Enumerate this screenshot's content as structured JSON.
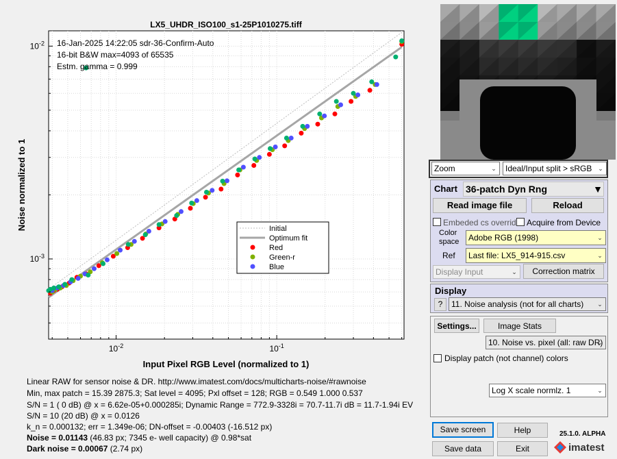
{
  "chart_data": {
    "type": "scatter",
    "title": "LX5_UHDR_ISO100_s1-25P1010275.tiff",
    "xlabel": "Input Pixel RGB Level (normalized to 1)",
    "ylabel": "Noise  normalized to 1",
    "xscale": "log",
    "yscale": "log",
    "xlim": [
      0.0038,
      0.62
    ],
    "ylim": [
      0.00042,
      0.0118
    ],
    "x_ticks": [
      {
        "value": 0.01,
        "label": "10^-2"
      },
      {
        "value": 0.1,
        "label": "10^-1"
      }
    ],
    "y_ticks": [
      {
        "value": 0.001,
        "label": "10^-3"
      },
      {
        "value": 0.01,
        "label": "10^-2"
      }
    ],
    "grid": true,
    "legend_position": "center-right",
    "annotations": [
      "16-Jan-2025 14:22:05   sdr-36-Confirm-Auto",
      "16-bit B&W  max=4093 of 65535",
      "Estm. gamma = 0.999"
    ],
    "series": [
      {
        "name": "Initial",
        "kind": "line",
        "color": "#bdbdbd",
        "x": [
          0.0038,
          0.6
        ],
        "y": [
          0.00072,
          0.0116
        ]
      },
      {
        "name": "Optimum fit",
        "kind": "line",
        "color": "#a6a6a6",
        "x": [
          0.0038,
          0.6
        ],
        "y": [
          0.00066,
          0.0099
        ]
      },
      {
        "name": "Red",
        "kind": "points",
        "color": "#ff0000",
        "x": [
          0.0039,
          0.0041,
          0.0043,
          0.0046,
          0.0051,
          0.0057,
          0.0065,
          0.0078,
          0.0096,
          0.0118,
          0.0146,
          0.0185,
          0.0232,
          0.029,
          0.036,
          0.045,
          0.057,
          0.072,
          0.09,
          0.112,
          0.142,
          0.18,
          0.23,
          0.29,
          0.38,
          0.6
        ],
        "y": [
          0.00069,
          0.00071,
          0.00072,
          0.00074,
          0.00077,
          0.00082,
          0.00085,
          0.00093,
          0.00103,
          0.00113,
          0.00125,
          0.0014,
          0.00154,
          0.00173,
          0.00195,
          0.00213,
          0.00248,
          0.00275,
          0.0031,
          0.0034,
          0.0039,
          0.0043,
          0.0048,
          0.0055,
          0.0062,
          0.0102
        ]
      },
      {
        "name": "Green-r",
        "kind": "points",
        "color": "#7fb000",
        "x": [
          0.004,
          0.0042,
          0.0045,
          0.0049,
          0.0054,
          0.006,
          0.0069,
          0.0082,
          0.0101,
          0.0124,
          0.0153,
          0.0193,
          0.0242,
          0.0302,
          0.0376,
          0.047,
          0.059,
          0.075,
          0.094,
          0.118,
          0.149,
          0.19,
          0.24,
          0.31,
          0.41,
          0.6
        ],
        "y": [
          0.0007,
          0.00072,
          0.00073,
          0.00075,
          0.00079,
          0.00083,
          0.00087,
          0.00096,
          0.00106,
          0.00117,
          0.00131,
          0.00146,
          0.00162,
          0.00182,
          0.00204,
          0.00226,
          0.00262,
          0.0029,
          0.00326,
          0.0036,
          0.0041,
          0.0046,
          0.0052,
          0.0058,
          0.0066,
          0.0105
        ]
      },
      {
        "name": "Blue",
        "kind": "points",
        "color": "#5050ff",
        "x": [
          0.004,
          0.0043,
          0.0047,
          0.0052,
          0.0058,
          0.0064,
          0.0073,
          0.0088,
          0.0106,
          0.013,
          0.016,
          0.0202,
          0.0254,
          0.0318,
          0.0396,
          0.049,
          0.062,
          0.078,
          0.098,
          0.123,
          0.155,
          0.198,
          0.25,
          0.32,
          0.42
        ],
        "y": [
          0.00071,
          0.00073,
          0.00075,
          0.00078,
          0.00081,
          0.00085,
          0.0009,
          0.00099,
          0.0011,
          0.00121,
          0.00135,
          0.0015,
          0.00167,
          0.00188,
          0.0021,
          0.00233,
          0.0027,
          0.003,
          0.00336,
          0.0037,
          0.0042,
          0.0047,
          0.0053,
          0.0059,
          0.0066
        ]
      },
      {
        "name": "",
        "kind": "points",
        "color": "#00b070",
        "x": [
          0.0038,
          0.0039,
          0.0041,
          0.0044,
          0.0048,
          0.0053,
          0.0067,
          0.0083,
          0.0119,
          0.0152,
          0.0185,
          0.0238,
          0.0295,
          0.0365,
          0.046,
          0.058,
          0.073,
          0.091,
          0.115,
          0.145,
          0.185,
          0.235,
          0.3,
          0.39,
          0.55,
          0.6,
          0.0065
        ],
        "y": [
          0.00071,
          0.00072,
          0.00073,
          0.00074,
          0.00076,
          0.0008,
          0.00084,
          0.00095,
          0.00117,
          0.0013,
          0.00145,
          0.0016,
          0.00183,
          0.00206,
          0.00232,
          0.00262,
          0.00295,
          0.0033,
          0.0037,
          0.0042,
          0.0048,
          0.0055,
          0.006,
          0.0068,
          0.0089,
          0.0106,
          0.0079
        ]
      }
    ],
    "legend": [
      "Initial",
      "Optimum fit",
      "Red",
      "Green-r",
      "Blue"
    ]
  },
  "info": {
    "line1": "Linear RAW for sensor noise & DR.  http://www.imatest.com/docs/multicharts-noise/#rawnoise",
    "line2": "Min, max patch = 15.39  2875.3;   Sat level = 4095;   Pxl offset = 128;   RGB = 0.549  1.000  0.537",
    "line3": "S/N =  1   ( 0 dB) @ x = 6.62e-05+0.000285i;   Dynamic Range = 772.9-3328i = 70.7-11.7i dB = 11.7-1.94i EV",
    "line4": "S/N = 10 (20 dB) @ x = 0.0126",
    "line5": "k_n = 0.000132;      err = 1.349e-06;      DN-offset = -0.00403  (-16.512 px)",
    "noise_bold": "Noise = 0.01143",
    "noise_rest": " (46.83 px;  7345 e- well capacity) @ 0.98*sat",
    "dark_bold": "Dark noise = 0.00067",
    "dark_rest": " (2.74 px)"
  },
  "thumbnail": {
    "highlight_color": "#00b070"
  },
  "controls": {
    "zoom": "Zoom",
    "view_mode": "Ideal/Input split > sRGB",
    "chart_label": "Chart",
    "chart_type": "36-patch Dyn Rng",
    "read_image": "Read image file",
    "reload": "Reload",
    "embedded_cs": "Embeded cs override",
    "acquire": "Acquire from Device",
    "color_space_label1": "Color",
    "color_space_label2": "space",
    "color_space": "Adobe RGB (1998)",
    "ref_label": "Ref",
    "ref_value": "Last file: LX5_914-915.csv",
    "display_input": "Display Input",
    "correction_matrix": "Correction matrix",
    "display_label": "Display",
    "help_q": "?",
    "display_mode": "11. Noise analysis (not for all charts)",
    "settings": "Settings...",
    "image_stats": "Image Stats",
    "plot_mode": "10. Noise vs. pixel (all: raw DR)",
    "display_patch": "Display patch (not channel) colors",
    "scale_mode": "Log X scale normlz. 1",
    "save_screen": "Save screen",
    "help": "Help",
    "save_data": "Save data",
    "exit": "Exit",
    "version": "25.1.0. ALPHA",
    "logo": "imatest"
  }
}
